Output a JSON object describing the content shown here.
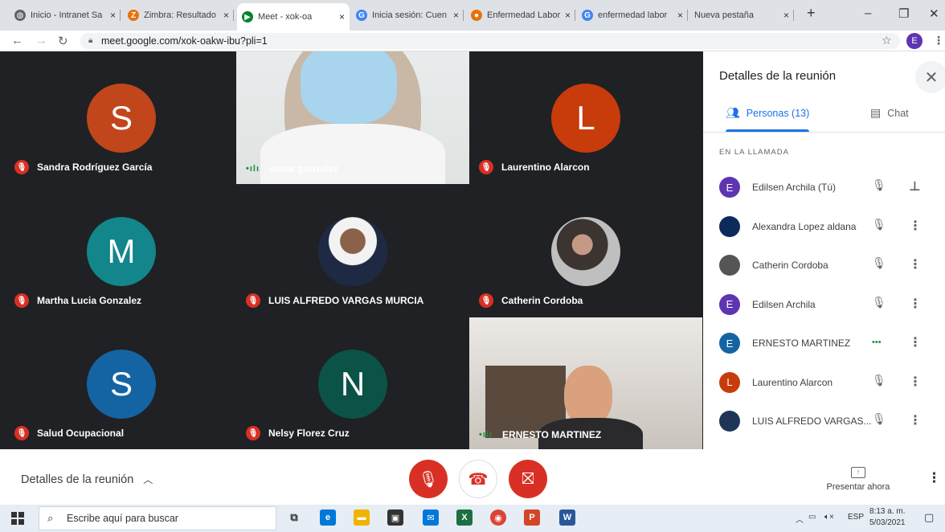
{
  "browser": {
    "tabs": [
      {
        "title": "Inicio - Intranet Sa",
        "close": "×",
        "fav": "◍",
        "favbg": "#5f6368"
      },
      {
        "title": "Zimbra: Resultado",
        "close": "×",
        "fav": "Z",
        "favbg": "#e8710a"
      },
      {
        "title": "Meet - xok-oa",
        "close": "×",
        "fav": "▶",
        "favbg": "#00832d",
        "active": true
      },
      {
        "title": "Inicia sesión: Cuen",
        "close": "×",
        "fav": "G",
        "favbg": "#4285f4"
      },
      {
        "title": "Enfermedad Labor",
        "close": "×",
        "fav": "●",
        "favbg": "#e8710a"
      },
      {
        "title": "enfermedad labor",
        "close": "×",
        "fav": "G",
        "favbg": "#4285f4"
      },
      {
        "title": "Nueva pestaña",
        "close": "×",
        "fav": "",
        "favbg": ""
      }
    ],
    "new_tab": "+",
    "url": "meet.google.com/xok-oakw-ibu?pli=1",
    "profile_initial": "E"
  },
  "participants_grid": [
    {
      "name": "Sandra Rodríguez García",
      "initial": "S",
      "color": "#c1461b",
      "muted": true,
      "kind": "avatar"
    },
    {
      "name": "oscar gonzalez",
      "muted": false,
      "kind": "video-mask"
    },
    {
      "name": "Laurentino Alarcon",
      "initial": "L",
      "color": "#c83b0a",
      "muted": true,
      "kind": "avatar"
    },
    {
      "name": "Martha Lucia Gonzalez",
      "initial": "M",
      "color": "#12868a",
      "muted": true,
      "kind": "avatar"
    },
    {
      "name": "LUIS ALFREDO VARGAS MURCIA",
      "muted": true,
      "kind": "photo-suit"
    },
    {
      "name": "Catherin Cordoba",
      "muted": true,
      "kind": "photo-woman"
    },
    {
      "name": "Salud Ocupacional",
      "initial": "S",
      "color": "#1464a4",
      "muted": true,
      "kind": "avatar"
    },
    {
      "name": "Nelsy Florez Cruz",
      "initial": "N",
      "color": "#0b5347",
      "muted": true,
      "kind": "avatar"
    },
    {
      "name": "ERNESTO MARTINEZ",
      "muted": false,
      "kind": "video-room"
    }
  ],
  "sidebar": {
    "title": "Detalles de la reunión",
    "tab_people": "Personas (13)",
    "tab_chat": "Chat",
    "section": "EN LA LLAMADA",
    "people": [
      {
        "name": "Edilsen Archila (Tú)",
        "initial": "E",
        "color": "#5e35b1",
        "action": "pin"
      },
      {
        "name": "Alexandra Lopez aldana",
        "initial": "",
        "color": "#0d2a5c",
        "action": "more"
      },
      {
        "name": "Catherin Cordoba",
        "initial": "",
        "color": "#555",
        "action": "more"
      },
      {
        "name": "Edilsen Archila",
        "initial": "E",
        "color": "#5e35b1",
        "action": "more"
      },
      {
        "name": "ERNESTO MARTINEZ",
        "initial": "E",
        "color": "#1464a4",
        "action": "more",
        "speaking": true
      },
      {
        "name": "Laurentino Alarcon",
        "initial": "L",
        "color": "#c83b0a",
        "action": "more"
      },
      {
        "name": "LUIS ALFREDO VARGAS...",
        "initial": "",
        "color": "#1f3557",
        "action": "more"
      }
    ]
  },
  "bottom_bar": {
    "details_label": "Detalles de la reunión",
    "present_label": "Presentar ahora",
    "accent_red": "#d93025"
  },
  "taskbar": {
    "search_placeholder": "Escribe aquí para buscar",
    "lang": "ESP",
    "time": "8:13 a. m.",
    "date": "5/03/2021"
  }
}
